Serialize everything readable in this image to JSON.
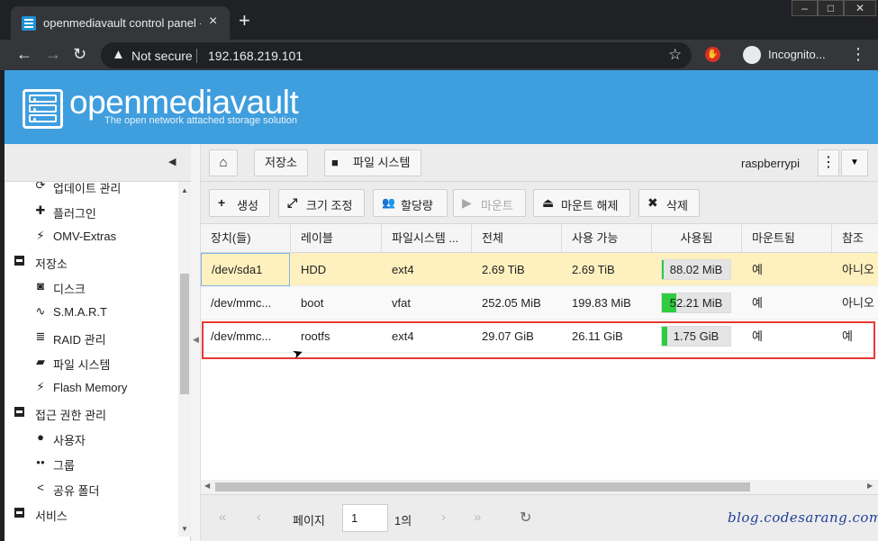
{
  "browser": {
    "tab_title": "openmediavault control panel - r",
    "tab_close": "×",
    "new_tab": "+",
    "window_controls": [
      "–",
      "□",
      "✕"
    ],
    "not_secure": "Not secure",
    "url": "192.168.219.101",
    "incognito_label": "Incognito...",
    "icons": [
      "back-icon",
      "forward-icon",
      "reload-icon",
      "warning-icon",
      "star-icon",
      "extension-icon",
      "incognito-icon",
      "menu-icon"
    ]
  },
  "header": {
    "brand": "openmediavault",
    "tagline": "The open network attached storage solution",
    "color": "#3f9ede"
  },
  "sidebar": {
    "items": [
      {
        "label": "업데이트 관리",
        "icon": "update-icon",
        "glyph": "⟳",
        "level": 2
      },
      {
        "label": "플러그인",
        "icon": "puzzle-icon",
        "glyph": "✚",
        "level": 2
      },
      {
        "label": "OMV-Extras",
        "icon": "plug-icon",
        "glyph": "⚡",
        "level": 2
      },
      {
        "label": "저장소",
        "icon": "collapse-icon",
        "glyph": "▬",
        "level": 1
      },
      {
        "label": "디스크",
        "icon": "disk-icon",
        "glyph": "◙",
        "level": 2
      },
      {
        "label": "S.M.A.R.T",
        "icon": "pulse-icon",
        "glyph": "∿",
        "level": 2
      },
      {
        "label": "RAID 관리",
        "icon": "database-icon",
        "glyph": "≣",
        "level": 2
      },
      {
        "label": "파일 시스템",
        "icon": "folder-icon",
        "glyph": "▰",
        "level": 2
      },
      {
        "label": "Flash Memory",
        "icon": "flash-icon",
        "glyph": "⚡",
        "level": 2
      },
      {
        "label": "접근 권한 관리",
        "icon": "collapse-icon",
        "glyph": "▬",
        "level": 1
      },
      {
        "label": "사용자",
        "icon": "user-icon",
        "glyph": "●",
        "level": 2
      },
      {
        "label": "그룹",
        "icon": "users-icon",
        "glyph": "●●",
        "level": 2
      },
      {
        "label": "공유 폴더",
        "icon": "share-icon",
        "glyph": "<",
        "level": 2
      },
      {
        "label": "서비스",
        "icon": "collapse-icon",
        "glyph": "▬",
        "level": 1
      }
    ]
  },
  "breadcrumb": {
    "home_icon": "home-icon",
    "items": [
      "저장소",
      "파일 시스템"
    ],
    "hostname": "raspberrypi"
  },
  "toolbar": {
    "buttons": [
      {
        "label": "생성",
        "icon": "plus-icon",
        "glyph": "+",
        "enabled": true
      },
      {
        "label": "크기 조정",
        "icon": "expand-icon",
        "glyph": "⤢",
        "enabled": true
      },
      {
        "label": "할당량",
        "icon": "users-icon",
        "glyph": "👥",
        "enabled": true
      },
      {
        "label": "마운트",
        "icon": "play-icon",
        "glyph": "▶",
        "enabled": false
      },
      {
        "label": "마운트 해제",
        "icon": "eject-icon",
        "glyph": "⏏",
        "enabled": true
      },
      {
        "label": "삭제",
        "icon": "delete-icon",
        "glyph": "✖",
        "enabled": true
      }
    ]
  },
  "grid": {
    "columns": [
      "장치(들)",
      "레이블",
      "파일시스템 ...",
      "전체",
      "사용 가능",
      "사용됨",
      "마운트됨",
      "참조"
    ],
    "rows": [
      {
        "device": "/dev/sda1",
        "label": "HDD",
        "fs": "ext4",
        "total": "2.69 TiB",
        "available": "2.69 TiB",
        "used": "88.02 MiB",
        "used_fraction": 0.01,
        "mounted": "예",
        "referenced": "아니오",
        "selected": true
      },
      {
        "device": "/dev/mmc...",
        "label": "boot",
        "fs": "vfat",
        "total": "252.05 MiB",
        "available": "199.83 MiB",
        "used": "52.21 MiB",
        "used_fraction": 0.21,
        "mounted": "예",
        "referenced": "아니오",
        "selected": false
      },
      {
        "device": "/dev/mmc...",
        "label": "rootfs",
        "fs": "ext4",
        "total": "29.07 GiB",
        "available": "26.11 GiB",
        "used": "1.75 GiB",
        "used_fraction": 0.08,
        "mounted": "예",
        "referenced": "예",
        "selected": false
      }
    ],
    "selected_color": "#fff1bf",
    "used_bar_color": "#2ecc40"
  },
  "pager": {
    "page_label": "페이지",
    "page_value": "1",
    "page_of": "1의",
    "icons": [
      "first-page-icon",
      "prev-page-icon",
      "next-page-icon",
      "last-page-icon",
      "refresh-icon"
    ]
  },
  "watermark": "blog.codesarang.com"
}
